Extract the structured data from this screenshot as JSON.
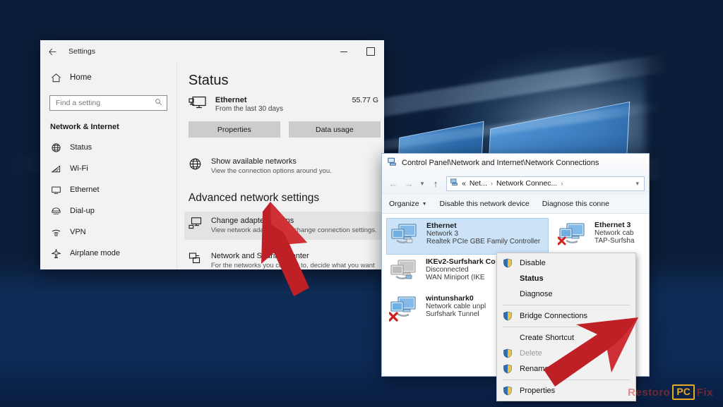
{
  "desktop": {
    "wallpaper_name": "windows-10-hero-wallpaper",
    "background_color": "#0b1d38"
  },
  "settings_window": {
    "titlebar": {
      "back_icon": "back-arrow-icon",
      "title": "Settings",
      "minimize_label": "–",
      "maximize_label": "□"
    },
    "nav": {
      "home_label": "Home",
      "home_icon": "home-icon",
      "search": {
        "placeholder": "Find a setting",
        "value": "",
        "icon": "search-icon"
      },
      "section_label": "Network & Internet",
      "items": [
        {
          "label": "Status",
          "icon": "globe-icon"
        },
        {
          "label": "Wi-Fi",
          "icon": "wifi-icon"
        },
        {
          "label": "Ethernet",
          "icon": "ethernet-icon"
        },
        {
          "label": "Dial-up",
          "icon": "dialup-icon"
        },
        {
          "label": "VPN",
          "icon": "vpn-icon"
        },
        {
          "label": "Airplane mode",
          "icon": "airplane-icon"
        }
      ]
    },
    "main": {
      "page_title": "Status",
      "status": {
        "icon": "ethernet-monitor-icon",
        "name": "Ethernet",
        "sub": "From the last 30 days",
        "usage": "55.77 G"
      },
      "buttons": {
        "properties": "Properties",
        "data_usage": "Data usage"
      },
      "show_networks": {
        "icon": "globe-icon",
        "title": "Show available networks",
        "sub": "View the connection options around you."
      },
      "advanced_heading": "Advanced network settings",
      "advanced_items": [
        {
          "icon": "adapter-icon",
          "title": "Change adapter options",
          "sub": "View network adapters and change connection settings.",
          "highlighted": true
        },
        {
          "icon": "sharing-icon",
          "title": "Network and Sharing Center",
          "sub": "For the networks you connect to, decide what you want to sha",
          "highlighted": false
        }
      ]
    }
  },
  "control_panel_window": {
    "titlebar": {
      "icon": "network-connections-icon",
      "title": "Control Panel\\Network and Internet\\Network Connections"
    },
    "address_bar": {
      "back_icon": "back-arrow-icon",
      "forward_icon": "forward-arrow-icon",
      "recent_icon": "chevron-down-icon",
      "up_icon": "up-arrow-icon",
      "path_icon": "network-connections-icon",
      "crumbs": [
        "«",
        "Net...",
        "Network Connec..."
      ],
      "separator": "›",
      "dropdown_icon": "chevron-down-icon"
    },
    "toolbar": [
      {
        "label": "Organize",
        "has_caret": true
      },
      {
        "label": "Disable this network device",
        "has_caret": false
      },
      {
        "label": "Diagnose this conne",
        "has_caret": false
      }
    ],
    "connections": [
      {
        "name": "Ethernet",
        "state": "Network 3",
        "driver": "Realtek PCIe GBE Family Controller",
        "icon": "network-adapter-icon",
        "selected": true,
        "error": false
      },
      {
        "name": "IKEv2-Surfshark Co",
        "state": "Disconnected",
        "driver": "WAN Miniport (IKE",
        "icon": "network-adapter-icon",
        "selected": false,
        "error": false
      },
      {
        "name": "wintunshark0",
        "state": "Network cable unpl",
        "driver": "Surfshark Tunnel",
        "icon": "network-adapter-icon",
        "selected": false,
        "error": true
      }
    ],
    "connections_col2": [
      {
        "name": "Ethernet 3",
        "state": "Network cab",
        "driver": "TAP-Surfsha",
        "icon": "network-adapter-icon",
        "selected": false,
        "error": true
      }
    ]
  },
  "context_menu": {
    "items": [
      {
        "label": "Disable",
        "icon": "shield-icon",
        "bold": false,
        "disabled": false,
        "separator_after": false
      },
      {
        "label": "Status",
        "icon": "",
        "bold": true,
        "disabled": false,
        "separator_after": false
      },
      {
        "label": "Diagnose",
        "icon": "",
        "bold": false,
        "disabled": false,
        "separator_after": true
      },
      {
        "label": "Bridge Connections",
        "icon": "shield-icon",
        "bold": false,
        "disabled": false,
        "separator_after": true
      },
      {
        "label": "Create Shortcut",
        "icon": "",
        "bold": false,
        "disabled": false,
        "separator_after": false
      },
      {
        "label": "Delete",
        "icon": "shield-icon",
        "bold": false,
        "disabled": true,
        "separator_after": false
      },
      {
        "label": "Rename",
        "icon": "shield-icon",
        "bold": false,
        "disabled": false,
        "separator_after": true
      },
      {
        "label": "Properties",
        "icon": "shield-icon",
        "bold": false,
        "disabled": false,
        "separator_after": false
      }
    ]
  },
  "annotations": {
    "arrow_color": "#c1272d",
    "arrow_left_name": "red-arrow-pointing-to-change-adapter-options",
    "arrow_right_name": "red-arrow-pointing-to-properties"
  },
  "watermark": {
    "text_left": "Restoro",
    "logo_text": "PC",
    "text_right": "Fix",
    "logo_color": "#f0b323"
  }
}
